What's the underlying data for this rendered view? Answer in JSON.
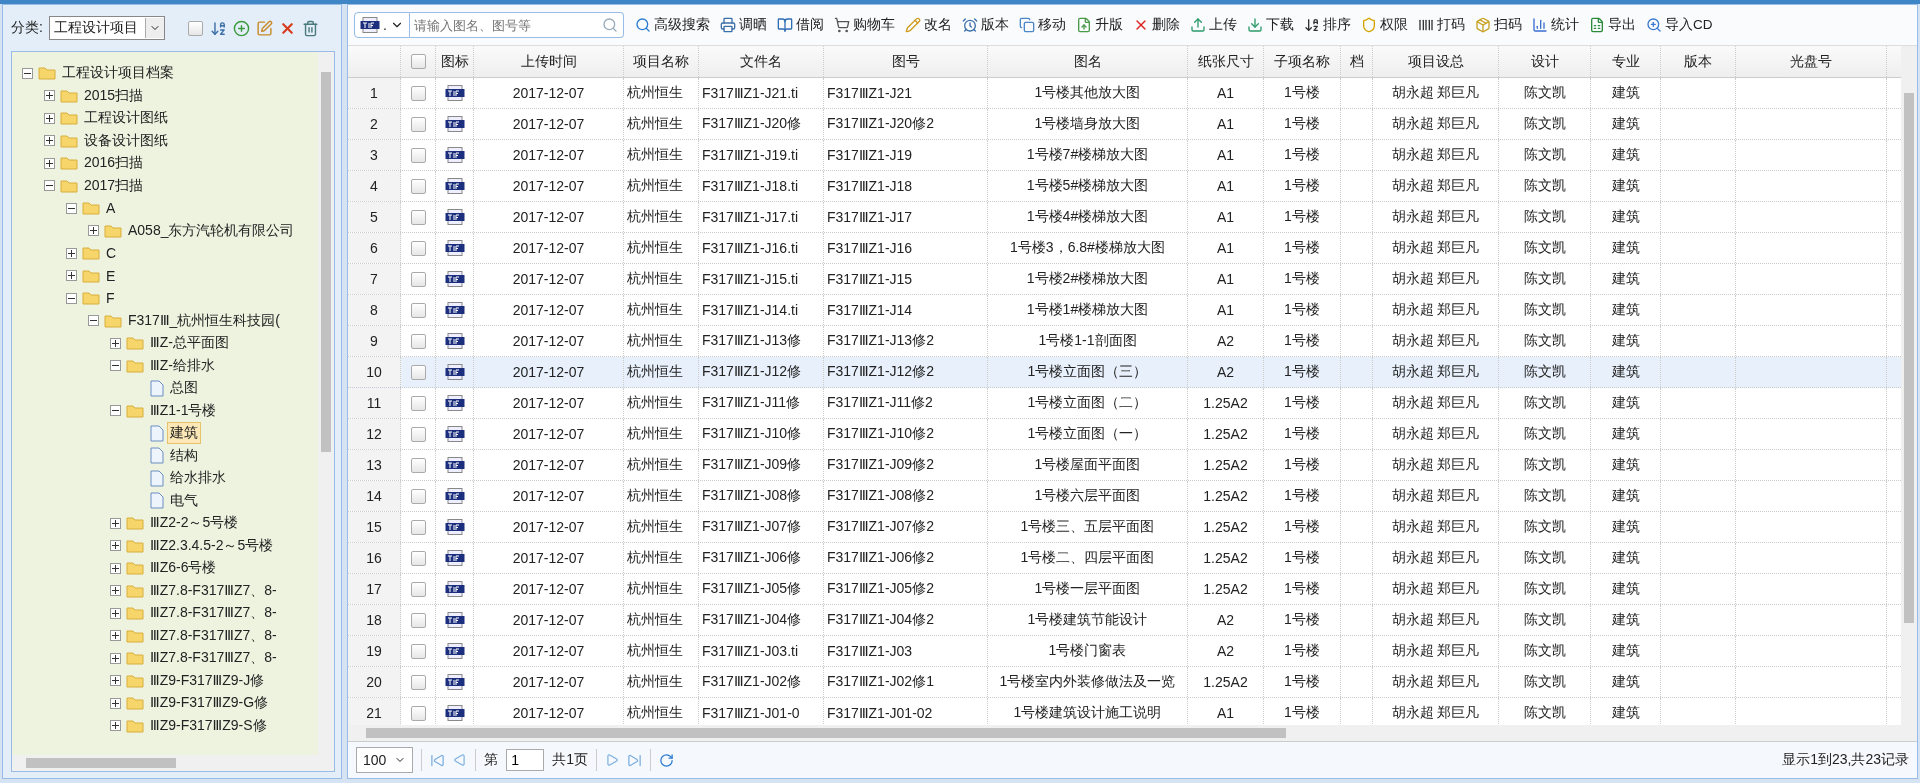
{
  "sidebar": {
    "category_label": "分类:",
    "category_value": "工程设计项目",
    "select_all": {
      "checked": false
    },
    "tree": [
      {
        "label": "工程设计项目档案",
        "kind": "folder",
        "expanded": true,
        "selected": false,
        "children": [
          {
            "label": "2015扫描",
            "kind": "folder",
            "expanded": false,
            "selected": false
          },
          {
            "label": "工程设计图纸",
            "kind": "folder",
            "expanded": false,
            "selected": false
          },
          {
            "label": "设备设计图纸",
            "kind": "folder",
            "expanded": false,
            "selected": false
          },
          {
            "label": "2016扫描",
            "kind": "folder",
            "expanded": false,
            "selected": false
          },
          {
            "label": "2017扫描",
            "kind": "folder",
            "expanded": true,
            "selected": false,
            "children": [
              {
                "label": "A",
                "kind": "folder",
                "expanded": true,
                "selected": false,
                "children": [
                  {
                    "label": "A058_东方汽轮机有限公司",
                    "kind": "folder",
                    "expanded": false,
                    "selected": false
                  }
                ]
              },
              {
                "label": "C",
                "kind": "folder",
                "expanded": false,
                "selected": false
              },
              {
                "label": "E",
                "kind": "folder",
                "expanded": false,
                "selected": false
              },
              {
                "label": "F",
                "kind": "folder",
                "expanded": true,
                "selected": false,
                "children": [
                  {
                    "label": "F317Ⅲ_杭州恒生科技园(",
                    "kind": "folder",
                    "expanded": true,
                    "selected": false,
                    "children": [
                      {
                        "label": "ⅢZ-总平面图",
                        "kind": "folder",
                        "expanded": false,
                        "selected": false
                      },
                      {
                        "label": "ⅢZ-给排水",
                        "kind": "folder",
                        "expanded": true,
                        "selected": false,
                        "children": [
                          {
                            "label": "总图",
                            "kind": "file",
                            "selected": false
                          }
                        ]
                      },
                      {
                        "label": "ⅢZ1-1号楼",
                        "kind": "folder",
                        "expanded": true,
                        "selected": false,
                        "children": [
                          {
                            "label": "建筑",
                            "kind": "file",
                            "selected": true
                          },
                          {
                            "label": "结构",
                            "kind": "file",
                            "selected": false
                          },
                          {
                            "label": "给水排水",
                            "kind": "file",
                            "selected": false
                          },
                          {
                            "label": "电气",
                            "kind": "file",
                            "selected": false
                          }
                        ]
                      },
                      {
                        "label": "ⅢZ2-2～5号楼",
                        "kind": "folder",
                        "expanded": false,
                        "selected": false
                      },
                      {
                        "label": "ⅢZ2.3.4.5-2～5号楼",
                        "kind": "folder",
                        "expanded": false,
                        "selected": false
                      },
                      {
                        "label": "ⅢZ6-6号楼",
                        "kind": "folder",
                        "expanded": false,
                        "selected": false
                      },
                      {
                        "label": "ⅢZ7.8-F317ⅢZ7、8-",
                        "kind": "folder",
                        "expanded": false,
                        "selected": false
                      },
                      {
                        "label": "ⅢZ7.8-F317ⅢZ7、8-",
                        "kind": "folder",
                        "expanded": false,
                        "selected": false
                      },
                      {
                        "label": "ⅢZ7.8-F317ⅢZ7、8-",
                        "kind": "folder",
                        "expanded": false,
                        "selected": false
                      },
                      {
                        "label": "ⅢZ7.8-F317ⅢZ7、8-",
                        "kind": "folder",
                        "expanded": false,
                        "selected": false
                      },
                      {
                        "label": "ⅢZ9-F317ⅢZ9-J修",
                        "kind": "folder",
                        "expanded": false,
                        "selected": false
                      },
                      {
                        "label": "ⅢZ9-F317ⅢZ9-G修",
                        "kind": "folder",
                        "expanded": false,
                        "selected": false
                      },
                      {
                        "label": "ⅢZ9-F317ⅢZ9-S修",
                        "kind": "folder",
                        "expanded": false,
                        "selected": false
                      }
                    ]
                  }
                ]
              }
            ]
          }
        ]
      }
    ]
  },
  "toolbar": {
    "file_type": ".",
    "search": {
      "placeholder": "请输入图名、图号等"
    },
    "buttons": [
      "高级搜索",
      "调晒",
      "借阅",
      "购物车",
      "改名",
      "版本",
      "移动",
      "升版",
      "删除",
      "上传",
      "下载",
      "排序",
      "权限",
      "打码",
      "扫码",
      "统计",
      "导出",
      "导入CD"
    ]
  },
  "table": {
    "select_all": {
      "checked": false
    },
    "columns": [
      "图标",
      "上传时间",
      "项目名称",
      "文件名",
      "图号",
      "图名",
      "纸张尺寸",
      "子项名称",
      "档",
      "项目设总",
      "设计",
      "专业",
      "版本",
      "光盘号"
    ],
    "rows": [
      {
        "no": "1",
        "checked": false,
        "selected": false,
        "time": "2017-12-07",
        "project": "杭州恒生",
        "file": "F317ⅢZ1-J21.ti",
        "code": "F317ⅢZ1-J21",
        "name": "1号楼其他放大图",
        "paper": "A1",
        "sub": "1号楼",
        "chief": "胡永超 郑巨凡",
        "designer": "陈文凯",
        "major": "建筑"
      },
      {
        "no": "2",
        "checked": false,
        "selected": false,
        "time": "2017-12-07",
        "project": "杭州恒生",
        "file": "F317ⅢZ1-J20修",
        "code": "F317ⅢZ1-J20修2",
        "name": "1号楼墙身放大图",
        "paper": "A1",
        "sub": "1号楼",
        "chief": "胡永超 郑巨凡",
        "designer": "陈文凯",
        "major": "建筑"
      },
      {
        "no": "3",
        "checked": false,
        "selected": false,
        "time": "2017-12-07",
        "project": "杭州恒生",
        "file": "F317ⅢZ1-J19.ti",
        "code": "F317ⅢZ1-J19",
        "name": "1号楼7#楼梯放大图",
        "paper": "A1",
        "sub": "1号楼",
        "chief": "胡永超 郑巨凡",
        "designer": "陈文凯",
        "major": "建筑"
      },
      {
        "no": "4",
        "checked": false,
        "selected": false,
        "time": "2017-12-07",
        "project": "杭州恒生",
        "file": "F317ⅢZ1-J18.ti",
        "code": "F317ⅢZ1-J18",
        "name": "1号楼5#楼梯放大图",
        "paper": "A1",
        "sub": "1号楼",
        "chief": "胡永超 郑巨凡",
        "designer": "陈文凯",
        "major": "建筑"
      },
      {
        "no": "5",
        "checked": false,
        "selected": false,
        "time": "2017-12-07",
        "project": "杭州恒生",
        "file": "F317ⅢZ1-J17.ti",
        "code": "F317ⅢZ1-J17",
        "name": "1号楼4#楼梯放大图",
        "paper": "A1",
        "sub": "1号楼",
        "chief": "胡永超 郑巨凡",
        "designer": "陈文凯",
        "major": "建筑"
      },
      {
        "no": "6",
        "checked": false,
        "selected": false,
        "time": "2017-12-07",
        "project": "杭州恒生",
        "file": "F317ⅢZ1-J16.ti",
        "code": "F317ⅢZ1-J16",
        "name": "1号楼3，6.8#楼梯放大图",
        "paper": "A1",
        "sub": "1号楼",
        "chief": "胡永超 郑巨凡",
        "designer": "陈文凯",
        "major": "建筑"
      },
      {
        "no": "7",
        "checked": false,
        "selected": false,
        "time": "2017-12-07",
        "project": "杭州恒生",
        "file": "F317ⅢZ1-J15.ti",
        "code": "F317ⅢZ1-J15",
        "name": "1号楼2#楼梯放大图",
        "paper": "A1",
        "sub": "1号楼",
        "chief": "胡永超 郑巨凡",
        "designer": "陈文凯",
        "major": "建筑"
      },
      {
        "no": "8",
        "checked": false,
        "selected": false,
        "time": "2017-12-07",
        "project": "杭州恒生",
        "file": "F317ⅢZ1-J14.ti",
        "code": "F317ⅢZ1-J14",
        "name": "1号楼1#楼梯放大图",
        "paper": "A1",
        "sub": "1号楼",
        "chief": "胡永超 郑巨凡",
        "designer": "陈文凯",
        "major": "建筑"
      },
      {
        "no": "9",
        "checked": false,
        "selected": false,
        "time": "2017-12-07",
        "project": "杭州恒生",
        "file": "F317ⅢZ1-J13修",
        "code": "F317ⅢZ1-J13修2",
        "name": "1号楼1-1剖面图",
        "paper": "A2",
        "sub": "1号楼",
        "chief": "胡永超 郑巨凡",
        "designer": "陈文凯",
        "major": "建筑"
      },
      {
        "no": "10",
        "checked": false,
        "selected": true,
        "time": "2017-12-07",
        "project": "杭州恒生",
        "file": "F317ⅢZ1-J12修",
        "code": "F317ⅢZ1-J12修2",
        "name": "1号楼立面图（三）",
        "paper": "A2",
        "sub": "1号楼",
        "chief": "胡永超 郑巨凡",
        "designer": "陈文凯",
        "major": "建筑"
      },
      {
        "no": "11",
        "checked": false,
        "selected": false,
        "time": "2017-12-07",
        "project": "杭州恒生",
        "file": "F317ⅢZ1-J11修",
        "code": "F317ⅢZ1-J11修2",
        "name": "1号楼立面图（二）",
        "paper": "1.25A2",
        "sub": "1号楼",
        "chief": "胡永超 郑巨凡",
        "designer": "陈文凯",
        "major": "建筑"
      },
      {
        "no": "12",
        "checked": false,
        "selected": false,
        "time": "2017-12-07",
        "project": "杭州恒生",
        "file": "F317ⅢZ1-J10修",
        "code": "F317ⅢZ1-J10修2",
        "name": "1号楼立面图（一）",
        "paper": "1.25A2",
        "sub": "1号楼",
        "chief": "胡永超 郑巨凡",
        "designer": "陈文凯",
        "major": "建筑"
      },
      {
        "no": "13",
        "checked": false,
        "selected": false,
        "time": "2017-12-07",
        "project": "杭州恒生",
        "file": "F317ⅢZ1-J09修",
        "code": "F317ⅢZ1-J09修2",
        "name": "1号楼屋面平面图",
        "paper": "1.25A2",
        "sub": "1号楼",
        "chief": "胡永超 郑巨凡",
        "designer": "陈文凯",
        "major": "建筑"
      },
      {
        "no": "14",
        "checked": false,
        "selected": false,
        "time": "2017-12-07",
        "project": "杭州恒生",
        "file": "F317ⅢZ1-J08修",
        "code": "F317ⅢZ1-J08修2",
        "name": "1号楼六层平面图",
        "paper": "1.25A2",
        "sub": "1号楼",
        "chief": "胡永超 郑巨凡",
        "designer": "陈文凯",
        "major": "建筑"
      },
      {
        "no": "15",
        "checked": false,
        "selected": false,
        "time": "2017-12-07",
        "project": "杭州恒生",
        "file": "F317ⅢZ1-J07修",
        "code": "F317ⅢZ1-J07修2",
        "name": "1号楼三、五层平面图",
        "paper": "1.25A2",
        "sub": "1号楼",
        "chief": "胡永超 郑巨凡",
        "designer": "陈文凯",
        "major": "建筑"
      },
      {
        "no": "16",
        "checked": false,
        "selected": false,
        "time": "2017-12-07",
        "project": "杭州恒生",
        "file": "F317ⅢZ1-J06修",
        "code": "F317ⅢZ1-J06修2",
        "name": "1号楼二、四层平面图",
        "paper": "1.25A2",
        "sub": "1号楼",
        "chief": "胡永超 郑巨凡",
        "designer": "陈文凯",
        "major": "建筑"
      },
      {
        "no": "17",
        "checked": false,
        "selected": false,
        "time": "2017-12-07",
        "project": "杭州恒生",
        "file": "F317ⅢZ1-J05修",
        "code": "F317ⅢZ1-J05修2",
        "name": "1号楼一层平面图",
        "paper": "1.25A2",
        "sub": "1号楼",
        "chief": "胡永超 郑巨凡",
        "designer": "陈文凯",
        "major": "建筑"
      },
      {
        "no": "18",
        "checked": false,
        "selected": false,
        "time": "2017-12-07",
        "project": "杭州恒生",
        "file": "F317ⅢZ1-J04修",
        "code": "F317ⅢZ1-J04修2",
        "name": "1号楼建筑节能设计",
        "paper": "A2",
        "sub": "1号楼",
        "chief": "胡永超 郑巨凡",
        "designer": "陈文凯",
        "major": "建筑"
      },
      {
        "no": "19",
        "checked": false,
        "selected": false,
        "time": "2017-12-07",
        "project": "杭州恒生",
        "file": "F317ⅢZ1-J03.ti",
        "code": "F317ⅢZ1-J03",
        "name": "1号楼门窗表",
        "paper": "A2",
        "sub": "1号楼",
        "chief": "胡永超 郑巨凡",
        "designer": "陈文凯",
        "major": "建筑"
      },
      {
        "no": "20",
        "checked": false,
        "selected": false,
        "time": "2017-12-07",
        "project": "杭州恒生",
        "file": "F317ⅢZ1-J02修",
        "code": "F317ⅢZ1-J02修1",
        "name": "1号楼室内外装修做法及一览",
        "paper": "1.25A2",
        "sub": "1号楼",
        "chief": "胡永超 郑巨凡",
        "designer": "陈文凯",
        "major": "建筑"
      },
      {
        "no": "21",
        "checked": false,
        "selected": false,
        "time": "2017-12-07",
        "project": "杭州恒生",
        "file": "F317ⅢZ1-J01-0",
        "code": "F317ⅢZ1-J01-02",
        "name": "1号楼建筑设计施工说明",
        "paper": "A1",
        "sub": "1号楼",
        "chief": "胡永超 郑巨凡",
        "designer": "陈文凯",
        "major": "建筑"
      }
    ]
  },
  "pager": {
    "page_size": "100",
    "page_prefix": "第",
    "page": "1",
    "page_total": "共1页",
    "summary": "显示1到23,共23记录"
  }
}
